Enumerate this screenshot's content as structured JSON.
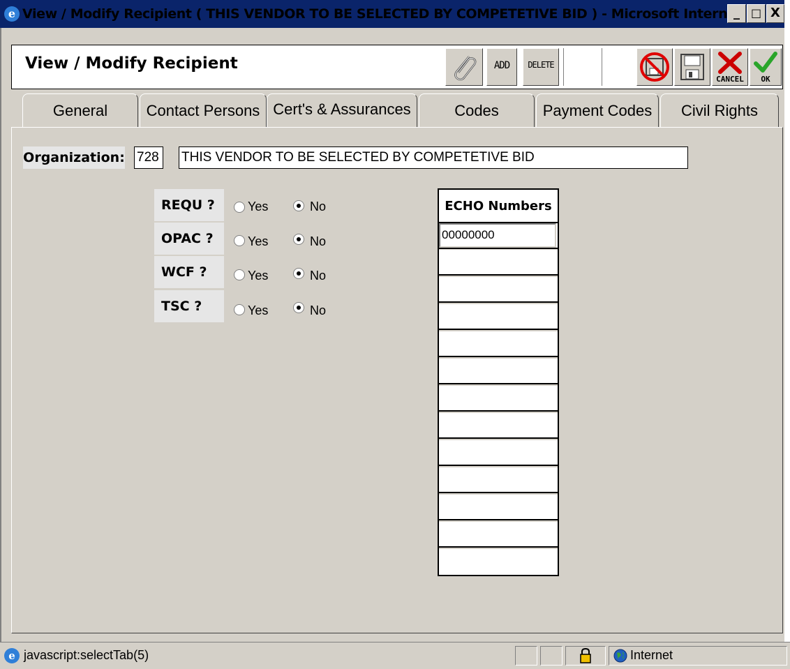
{
  "window": {
    "title": "View / Modify Recipient ( THIS VENDOR TO BE SELECTED BY COMPETETIVE BID ) - Microsoft Internet...",
    "minimize": "_",
    "maximize": "□",
    "close": "X"
  },
  "header": {
    "title": "View / Modify Recipient",
    "toolbar": {
      "attach_icon": "paperclip-icon",
      "add_label": "ADD",
      "delete_label": "DELETE",
      "no_save_icon": "no-save-icon",
      "save_icon": "save-icon",
      "cancel_label": "CANCEL",
      "ok_label": "OK"
    }
  },
  "tabs": [
    {
      "label": "General"
    },
    {
      "label": "Contact Persons"
    },
    {
      "label": "Cert's & Assurances"
    },
    {
      "label": "Codes"
    },
    {
      "label": "Payment Codes"
    },
    {
      "label": "Civil Rights"
    }
  ],
  "organization": {
    "label": "Organization:",
    "id": "728",
    "name": "THIS VENDOR TO BE SELECTED BY COMPETETIVE BID"
  },
  "questions": [
    {
      "label": "REQU ?",
      "yes": "Yes",
      "no": "No",
      "selected": "No"
    },
    {
      "label": "OPAC ?",
      "yes": "Yes",
      "no": "No",
      "selected": "No"
    },
    {
      "label": "WCF ?",
      "yes": "Yes",
      "no": "No",
      "selected": "No"
    },
    {
      "label": "TSC ?",
      "yes": "Yes",
      "no": "No",
      "selected": "No"
    }
  ],
  "echo": {
    "header": "ECHO Numbers",
    "rows": [
      "00000000",
      "",
      "",
      "",
      "",
      "",
      "",
      "",
      "",
      "",
      "",
      "",
      ""
    ]
  },
  "status": {
    "text": "javascript:selectTab(5)",
    "zone": "Internet"
  },
  "colors": {
    "titlebar": "#0a246a",
    "face": "#d4d0c8",
    "cancel_red": "#cc0000",
    "ok_green": "#2aa52a"
  }
}
